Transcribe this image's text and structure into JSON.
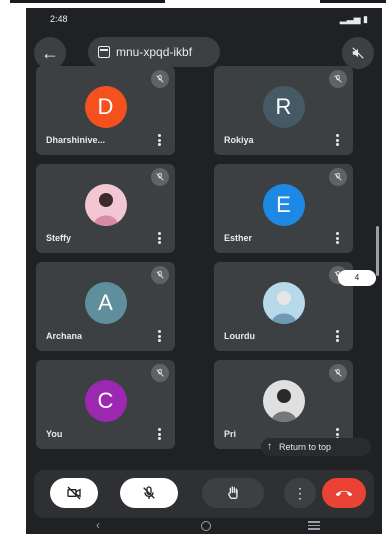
{
  "status": {
    "time": "2:48",
    "right_icons": "signal-battery"
  },
  "header": {
    "meeting_code": "mnu-xpqd-ikbf"
  },
  "participants": [
    {
      "name": "Dharshinive...",
      "initial": "D",
      "color": "#f4511e",
      "type": "initial"
    },
    {
      "name": "Rokiya",
      "initial": "R",
      "color": "#455a64",
      "type": "initial"
    },
    {
      "name": "Steffy",
      "initial": "",
      "color": "",
      "type": "photo"
    },
    {
      "name": "Esther",
      "initial": "E",
      "color": "#1e88e5",
      "type": "initial"
    },
    {
      "name": "Archana",
      "initial": "A",
      "color": "#5f8f9c",
      "type": "initial"
    },
    {
      "name": "Lourdu",
      "initial": "",
      "color": "",
      "type": "photo"
    },
    {
      "name": "You",
      "initial": "C",
      "color": "#9c27b0",
      "type": "initial"
    },
    {
      "name": "Pri",
      "initial": "",
      "color": "",
      "type": "photo"
    }
  ],
  "overlay": {
    "more_count": "4",
    "return_to_top": "Return to top"
  },
  "controls": {
    "camera": "camera-off-icon",
    "mic": "mic-off-icon",
    "hand": "raise-hand-icon",
    "more": "more-vert-icon",
    "end": "end-call-icon"
  }
}
